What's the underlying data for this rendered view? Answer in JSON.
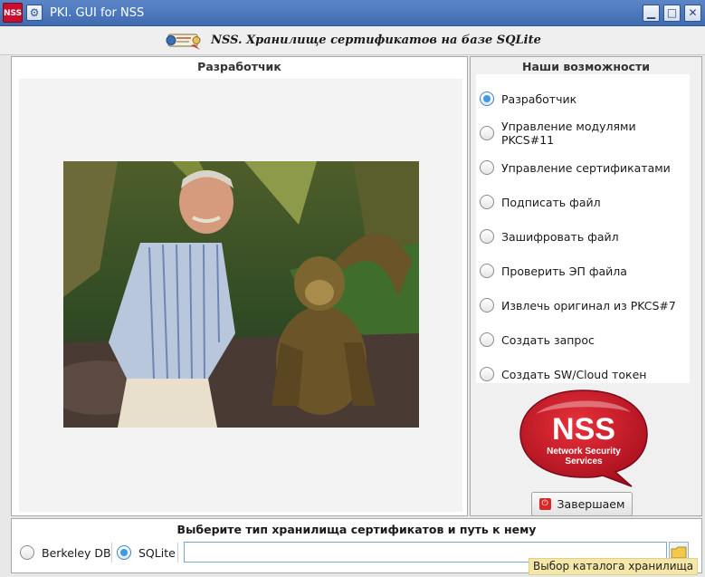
{
  "window": {
    "app_icon_text": "NSS",
    "title": "PKI. GUI for NSS",
    "minimize_glyph": "▁",
    "maximize_glyph": "□",
    "close_glyph": "✕",
    "menu_glyph": "⚙"
  },
  "header": {
    "title": "NSS. Хранилище сертификатов на базе SQLite"
  },
  "left_panel": {
    "title": "Разработчик"
  },
  "right_panel": {
    "title": "Наши возможности",
    "options": [
      {
        "label": "Разработчик",
        "selected": true
      },
      {
        "label": "Управление модулями PKCS#11",
        "selected": false
      },
      {
        "label": "Управление сертификатами",
        "selected": false
      },
      {
        "label": "Подписать файл",
        "selected": false
      },
      {
        "label": "Зашифровать файл",
        "selected": false
      },
      {
        "label": "Проверить ЭП файла",
        "selected": false
      },
      {
        "label": "Извлечь оригинал из PKCS#7",
        "selected": false
      },
      {
        "label": "Создать запрос",
        "selected": false
      },
      {
        "label": "Создать SW/Cloud токен",
        "selected": false
      }
    ],
    "logo": {
      "big": "NSS",
      "line1": "Network Security",
      "line2": "Services"
    },
    "exit_button": "Завершаем"
  },
  "bottom": {
    "title": "Выберите тип хранилища сертификатов и путь к нему",
    "db_options": [
      {
        "label": "Berkeley DB",
        "selected": false
      },
      {
        "label": "SQLite",
        "selected": true
      }
    ],
    "path_value": "",
    "tooltip": "Выбор каталога хранилища"
  },
  "colors": {
    "titlebar": "#4a76bb",
    "accent": "#3c9be6",
    "nss_red": "#c8102e"
  }
}
